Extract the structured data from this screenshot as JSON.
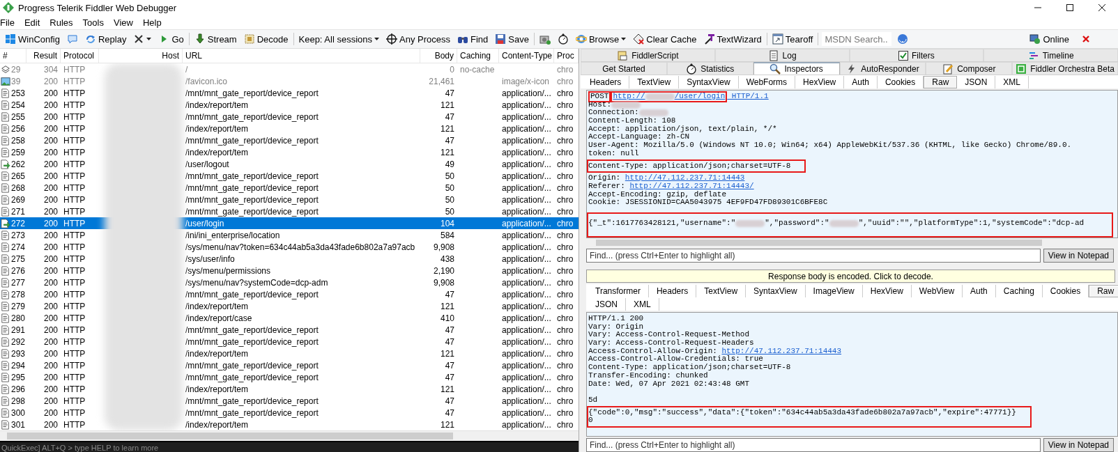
{
  "window": {
    "title": "Progress Telerik Fiddler Web Debugger"
  },
  "menu": [
    "File",
    "Edit",
    "Rules",
    "Tools",
    "View",
    "Help"
  ],
  "toolbar": {
    "groups": [
      [
        {
          "kind": "button",
          "label": "WinConfig"
        },
        {
          "kind": "icon"
        },
        {
          "kind": "button",
          "label": "Replay"
        },
        {
          "kind": "dropdown_icon"
        },
        {
          "kind": "button",
          "label": "Go"
        }
      ],
      [
        {
          "kind": "button",
          "label": "Stream"
        },
        {
          "kind": "button",
          "label": "Decode"
        }
      ],
      [
        {
          "kind": "dropdown",
          "label": "Keep: All sessions"
        },
        {
          "kind": "button",
          "label": "Any Process"
        },
        {
          "kind": "button",
          "label": "Find"
        },
        {
          "kind": "button",
          "label": "Save"
        }
      ],
      [
        {
          "kind": "icon"
        },
        {
          "kind": "icon"
        },
        {
          "kind": "dropdown",
          "label": "Browse"
        },
        {
          "kind": "button",
          "label": "Clear Cache"
        },
        {
          "kind": "button",
          "label": "TextWizard"
        }
      ],
      [
        {
          "kind": "button",
          "label": "Tearoff"
        }
      ],
      [
        {
          "kind": "search",
          "placeholder": "MSDN Search..."
        },
        {
          "kind": "icon"
        }
      ]
    ],
    "right": [
      {
        "kind": "button",
        "label": "Online"
      },
      {
        "kind": "icon"
      }
    ]
  },
  "sessions": {
    "columns": [
      "#",
      "Result",
      "Protocol",
      "Host",
      "URL",
      "Body",
      "Caching",
      "Content-Type",
      "Proc"
    ],
    "rows": [
      {
        "kind": "cache",
        "num": "29",
        "result": "304",
        "protocol": "HTTP",
        "url": "/",
        "body": "0",
        "caching": "no-cache",
        "content_type": "",
        "process": "chro",
        "selected": false,
        "dimmed": true
      },
      {
        "kind": "image",
        "num": "39",
        "result": "200",
        "protocol": "HTTP",
        "url": "/favicon.ico",
        "body": "21,461",
        "caching": "",
        "content_type": "image/x-icon",
        "process": "chro",
        "selected": false,
        "dimmed": true
      },
      {
        "kind": "script",
        "num": "253",
        "result": "200",
        "protocol": "HTTP",
        "url": "/mnt/mnt_gate_report/device_report",
        "body": "47",
        "caching": "",
        "content_type": "application/...",
        "process": "chro",
        "selected": false,
        "dimmed": false
      },
      {
        "kind": "script",
        "num": "254",
        "result": "200",
        "protocol": "HTTP",
        "url": "/index/report/tem",
        "body": "121",
        "caching": "",
        "content_type": "application/...",
        "process": "chro",
        "selected": false,
        "dimmed": false
      },
      {
        "kind": "script",
        "num": "255",
        "result": "200",
        "protocol": "HTTP",
        "url": "/mnt/mnt_gate_report/device_report",
        "body": "47",
        "caching": "",
        "content_type": "application/...",
        "process": "chro",
        "selected": false,
        "dimmed": false
      },
      {
        "kind": "script",
        "num": "256",
        "result": "200",
        "protocol": "HTTP",
        "url": "/index/report/tem",
        "body": "121",
        "caching": "",
        "content_type": "application/...",
        "process": "chro",
        "selected": false,
        "dimmed": false
      },
      {
        "kind": "script",
        "num": "258",
        "result": "200",
        "protocol": "HTTP",
        "url": "/mnt/mnt_gate_report/device_report",
        "body": "47",
        "caching": "",
        "content_type": "application/...",
        "process": "chro",
        "selected": false,
        "dimmed": false
      },
      {
        "kind": "script",
        "num": "259",
        "result": "200",
        "protocol": "HTTP",
        "url": "/index/report/tem",
        "body": "121",
        "caching": "",
        "content_type": "application/...",
        "process": "chro",
        "selected": false,
        "dimmed": false
      },
      {
        "kind": "post",
        "num": "262",
        "result": "200",
        "protocol": "HTTP",
        "url": "/user/logout",
        "body": "49",
        "caching": "",
        "content_type": "application/...",
        "process": "chro",
        "selected": false,
        "dimmed": false
      },
      {
        "kind": "script",
        "num": "265",
        "result": "200",
        "protocol": "HTTP",
        "url": "/mnt/mnt_gate_report/device_report",
        "body": "50",
        "caching": "",
        "content_type": "application/...",
        "process": "chro",
        "selected": false,
        "dimmed": false
      },
      {
        "kind": "script",
        "num": "268",
        "result": "200",
        "protocol": "HTTP",
        "url": "/mnt/mnt_gate_report/device_report",
        "body": "50",
        "caching": "",
        "content_type": "application/...",
        "process": "chro",
        "selected": false,
        "dimmed": false
      },
      {
        "kind": "script",
        "num": "269",
        "result": "200",
        "protocol": "HTTP",
        "url": "/mnt/mnt_gate_report/device_report",
        "body": "50",
        "caching": "",
        "content_type": "application/...",
        "process": "chro",
        "selected": false,
        "dimmed": false
      },
      {
        "kind": "script",
        "num": "271",
        "result": "200",
        "protocol": "HTTP",
        "url": "/mnt/mnt_gate_report/device_report",
        "body": "50",
        "caching": "",
        "content_type": "application/...",
        "process": "chro",
        "selected": false,
        "dimmed": false
      },
      {
        "kind": "post",
        "num": "272",
        "result": "200",
        "protocol": "HTTP",
        "url": "/user/login",
        "body": "104",
        "caching": "",
        "content_type": "application/...",
        "process": "chro",
        "selected": true,
        "dimmed": false
      },
      {
        "kind": "script",
        "num": "273",
        "result": "200",
        "protocol": "HTTP",
        "url": "/ini/ini_enterprise/location",
        "body": "584",
        "caching": "",
        "content_type": "application/...",
        "process": "chro",
        "selected": false,
        "dimmed": false
      },
      {
        "kind": "script",
        "num": "274",
        "result": "200",
        "protocol": "HTTP",
        "url": "/sys/menu/nav?token=634c44ab5a3da43fade6b802a7a97acb",
        "body": "9,908",
        "caching": "",
        "content_type": "application/...",
        "process": "chro",
        "selected": false,
        "dimmed": false
      },
      {
        "kind": "script",
        "num": "275",
        "result": "200",
        "protocol": "HTTP",
        "url": "/sys/user/info",
        "body": "438",
        "caching": "",
        "content_type": "application/...",
        "process": "chro",
        "selected": false,
        "dimmed": false
      },
      {
        "kind": "script",
        "num": "276",
        "result": "200",
        "protocol": "HTTP",
        "url": "/sys/menu/permissions",
        "body": "2,190",
        "caching": "",
        "content_type": "application/...",
        "process": "chro",
        "selected": false,
        "dimmed": false
      },
      {
        "kind": "script",
        "num": "277",
        "result": "200",
        "protocol": "HTTP",
        "url": "/sys/menu/nav?systemCode=dcp-adm",
        "body": "9,908",
        "caching": "",
        "content_type": "application/...",
        "process": "chro",
        "selected": false,
        "dimmed": false
      },
      {
        "kind": "script",
        "num": "278",
        "result": "200",
        "protocol": "HTTP",
        "url": "/mnt/mnt_gate_report/device_report",
        "body": "47",
        "caching": "",
        "content_type": "application/...",
        "process": "chro",
        "selected": false,
        "dimmed": false
      },
      {
        "kind": "script",
        "num": "279",
        "result": "200",
        "protocol": "HTTP",
        "url": "/index/report/tem",
        "body": "121",
        "caching": "",
        "content_type": "application/...",
        "process": "chro",
        "selected": false,
        "dimmed": false
      },
      {
        "kind": "script",
        "num": "280",
        "result": "200",
        "protocol": "HTTP",
        "url": "/index/report/case",
        "body": "410",
        "caching": "",
        "content_type": "application/...",
        "process": "chro",
        "selected": false,
        "dimmed": false
      },
      {
        "kind": "script",
        "num": "291",
        "result": "200",
        "protocol": "HTTP",
        "url": "/mnt/mnt_gate_report/device_report",
        "body": "47",
        "caching": "",
        "content_type": "application/...",
        "process": "chro",
        "selected": false,
        "dimmed": false
      },
      {
        "kind": "script",
        "num": "292",
        "result": "200",
        "protocol": "HTTP",
        "url": "/mnt/mnt_gate_report/device_report",
        "body": "47",
        "caching": "",
        "content_type": "application/...",
        "process": "chro",
        "selected": false,
        "dimmed": false
      },
      {
        "kind": "script",
        "num": "293",
        "result": "200",
        "protocol": "HTTP",
        "url": "/index/report/tem",
        "body": "121",
        "caching": "",
        "content_type": "application/...",
        "process": "chro",
        "selected": false,
        "dimmed": false
      },
      {
        "kind": "script",
        "num": "294",
        "result": "200",
        "protocol": "HTTP",
        "url": "/mnt/mnt_gate_report/device_report",
        "body": "47",
        "caching": "",
        "content_type": "application/...",
        "process": "chro",
        "selected": false,
        "dimmed": false
      },
      {
        "kind": "script",
        "num": "295",
        "result": "200",
        "protocol": "HTTP",
        "url": "/mnt/mnt_gate_report/device_report",
        "body": "47",
        "caching": "",
        "content_type": "application/...",
        "process": "chro",
        "selected": false,
        "dimmed": false
      },
      {
        "kind": "script",
        "num": "296",
        "result": "200",
        "protocol": "HTTP",
        "url": "/index/report/tem",
        "body": "121",
        "caching": "",
        "content_type": "application/...",
        "process": "chro",
        "selected": false,
        "dimmed": false
      },
      {
        "kind": "script",
        "num": "298",
        "result": "200",
        "protocol": "HTTP",
        "url": "/mnt/mnt_gate_report/device_report",
        "body": "47",
        "caching": "",
        "content_type": "application/...",
        "process": "chro",
        "selected": false,
        "dimmed": false
      },
      {
        "kind": "script",
        "num": "300",
        "result": "200",
        "protocol": "HTTP",
        "url": "/mnt/mnt_gate_report/device_report",
        "body": "47",
        "caching": "",
        "content_type": "application/...",
        "process": "chro",
        "selected": false,
        "dimmed": false
      },
      {
        "kind": "script",
        "num": "301",
        "result": "200",
        "protocol": "HTTP",
        "url": "/index/report/tem",
        "body": "121",
        "caching": "",
        "content_type": "application/...",
        "process": "chro",
        "selected": false,
        "dimmed": false
      }
    ]
  },
  "quickexec": {
    "text": "QuickExec] ALT+Q > type HELP to learn more"
  },
  "top_tabs": [
    [
      {
        "label": "FiddlerScript",
        "kind": "plain",
        "selected": false
      },
      {
        "label": "Log",
        "kind": "plain",
        "selected": false
      },
      {
        "label": "Filters",
        "kind": "checkbox",
        "checked": true,
        "selected": false
      },
      {
        "label": "Timeline",
        "kind": "plain",
        "selected": false
      }
    ],
    [
      {
        "label": "Get Started",
        "kind": "plain",
        "selected": false
      },
      {
        "label": "Statistics",
        "kind": "plain",
        "selected": false
      },
      {
        "label": "Inspectors",
        "kind": "plain",
        "selected": true
      },
      {
        "label": "AutoResponder",
        "kind": "plain",
        "selected": false
      },
      {
        "label": "Composer",
        "kind": "plain",
        "selected": false
      },
      {
        "label": "Fiddler Orchestra Beta",
        "kind": "plain",
        "selected": false
      }
    ]
  ],
  "request": {
    "tabs": [
      {
        "label": "Headers",
        "selected": false
      },
      {
        "label": "TextView",
        "selected": false
      },
      {
        "label": "SyntaxView",
        "selected": false
      },
      {
        "label": "WebForms",
        "selected": false
      },
      {
        "label": "HexView",
        "selected": false
      },
      {
        "label": "Auth",
        "selected": false
      },
      {
        "label": "Cookies",
        "selected": false
      },
      {
        "label": "Raw",
        "selected": true
      },
      {
        "label": "JSON",
        "selected": false
      },
      {
        "label": "XML",
        "selected": false
      }
    ],
    "lines": [
      {
        "boxed": false,
        "segments": [
          {
            "kind": "box",
            "children": [
              {
                "kind": "text",
                "text": "POST"
              }
            ]
          },
          {
            "kind": "box",
            "children": [
              {
                "kind": "link",
                "text": "http://"
              },
              {
                "kind": "redacted"
              },
              {
                "kind": "link",
                "text": "/user/login"
              }
            ]
          },
          {
            "kind": "link",
            "text": " HTTP/1.1"
          }
        ]
      },
      {
        "boxed": false,
        "segments": [
          {
            "kind": "text",
            "text": "Host:"
          },
          {
            "kind": "redacted"
          }
        ]
      },
      {
        "boxed": false,
        "segments": [
          {
            "kind": "text",
            "text": "Connection:"
          },
          {
            "kind": "redacted"
          }
        ]
      },
      {
        "boxed": false,
        "segments": [
          {
            "kind": "text",
            "text": "Content-Length: 108"
          }
        ]
      },
      {
        "boxed": false,
        "segments": [
          {
            "kind": "text",
            "text": "Accept: application/json, text/plain, */*"
          }
        ]
      },
      {
        "boxed": false,
        "segments": [
          {
            "kind": "text",
            "text": "Accept-Language: zh-CN"
          }
        ]
      },
      {
        "boxed": false,
        "segments": [
          {
            "kind": "text",
            "text": "User-Agent: Mozilla/5.0 (Windows NT 10.0; Win64; x64) AppleWebKit/537.36 (KHTML, like Gecko) Chrome/89.0."
          }
        ]
      },
      {
        "boxed": false,
        "segments": [
          {
            "kind": "text",
            "text": "token: null"
          }
        ]
      },
      {
        "boxed": true,
        "segments": [
          {
            "kind": "text",
            "text": "Content-Type: application/json;charset=UTF-8"
          }
        ]
      },
      {
        "boxed": false,
        "segments": [
          {
            "kind": "text",
            "text": "Origin: "
          },
          {
            "kind": "link",
            "text": "http://47.112.237.71:14443"
          }
        ]
      },
      {
        "boxed": false,
        "segments": [
          {
            "kind": "text",
            "text": "Referer: "
          },
          {
            "kind": "link",
            "text": "http://47.112.237.71:14443/"
          }
        ]
      },
      {
        "boxed": false,
        "segments": [
          {
            "kind": "text",
            "text": "Accept-Encoding: gzip, deflate"
          }
        ]
      },
      {
        "boxed": false,
        "segments": [
          {
            "kind": "text",
            "text": "Cookie: JSESSIONID=CAA5043975 4EF9FD47FD89301C6BFE8C"
          }
        ]
      },
      {
        "boxed": true,
        "segments": [
          {
            "kind": "text",
            "text": "{\"_t\":1617763428121,\"username\":\""
          },
          {
            "kind": "redacted"
          },
          {
            "kind": "text",
            "text": "\",\"password\":\""
          },
          {
            "kind": "redacted"
          },
          {
            "kind": "text",
            "text": "\",\"uuid\":\"\",\"platformType\":1,\"systemCode\":\"dcp-ad"
          }
        ]
      }
    ],
    "find_placeholder": "Find... (press Ctrl+Enter to highlight all)",
    "notepad_button": "View in Notepad"
  },
  "response": {
    "notice": "Response body is encoded. Click to decode.",
    "tabs": [
      [
        {
          "label": "Transformer",
          "selected": false
        },
        {
          "label": "Headers",
          "selected": false
        },
        {
          "label": "TextView",
          "selected": false
        },
        {
          "label": "SyntaxView",
          "selected": false
        },
        {
          "label": "ImageView",
          "selected": false
        },
        {
          "label": "HexView",
          "selected": false
        },
        {
          "label": "WebView",
          "selected": false
        },
        {
          "label": "Auth",
          "selected": false
        },
        {
          "label": "Caching",
          "selected": false
        },
        {
          "label": "Cookies",
          "selected": false
        },
        {
          "label": "Raw",
          "selected": true
        }
      ],
      [
        {
          "label": "JSON",
          "selected": false
        },
        {
          "label": "XML",
          "selected": false
        }
      ]
    ],
    "lines": [
      {
        "boxed": false,
        "segments": [
          {
            "kind": "text",
            "text": "HTTP/1.1 200"
          }
        ]
      },
      {
        "boxed": false,
        "segments": [
          {
            "kind": "text",
            "text": "Vary: Origin"
          }
        ]
      },
      {
        "boxed": false,
        "segments": [
          {
            "kind": "text",
            "text": "Vary: Access-Control-Request-Method"
          }
        ]
      },
      {
        "boxed": false,
        "segments": [
          {
            "kind": "text",
            "text": "Vary: Access-Control-Request-Headers"
          }
        ]
      },
      {
        "boxed": false,
        "segments": [
          {
            "kind": "text",
            "text": "Access-Control-Allow-Origin: "
          },
          {
            "kind": "link",
            "text": "http://47.112.237.71:14443"
          }
        ]
      },
      {
        "boxed": false,
        "segments": [
          {
            "kind": "text",
            "text": "Access-Control-Allow-Credentials: true"
          }
        ]
      },
      {
        "boxed": false,
        "segments": [
          {
            "kind": "text",
            "text": "Content-Type: application/json;charset=UTF-8"
          }
        ]
      },
      {
        "boxed": false,
        "segments": [
          {
            "kind": "text",
            "text": "Transfer-Encoding: chunked"
          }
        ]
      },
      {
        "boxed": false,
        "segments": [
          {
            "kind": "text",
            "text": "Date: Wed, 07 Apr 2021 02:43:48 GMT"
          }
        ]
      },
      {
        "boxed": false
      },
      {
        "boxed": false,
        "segments": [
          {
            "kind": "text",
            "text": "5d"
          }
        ]
      },
      {
        "boxed": true,
        "segments": [
          {
            "kind": "text",
            "text": "{\"code\":0,\"msg\":\"success\",\"data\":{\"token\":\"634c44ab5a3da43fade6b802a7a97acb\",\"expire\":47771}}"
          }
        ]
      },
      {
        "boxed": true,
        "segments": [
          {
            "kind": "text",
            "text": "0"
          }
        ]
      }
    ],
    "find_placeholder": "Find... (press Ctrl+Enter to highlight all)",
    "notepad_button": "View in Notepad"
  }
}
